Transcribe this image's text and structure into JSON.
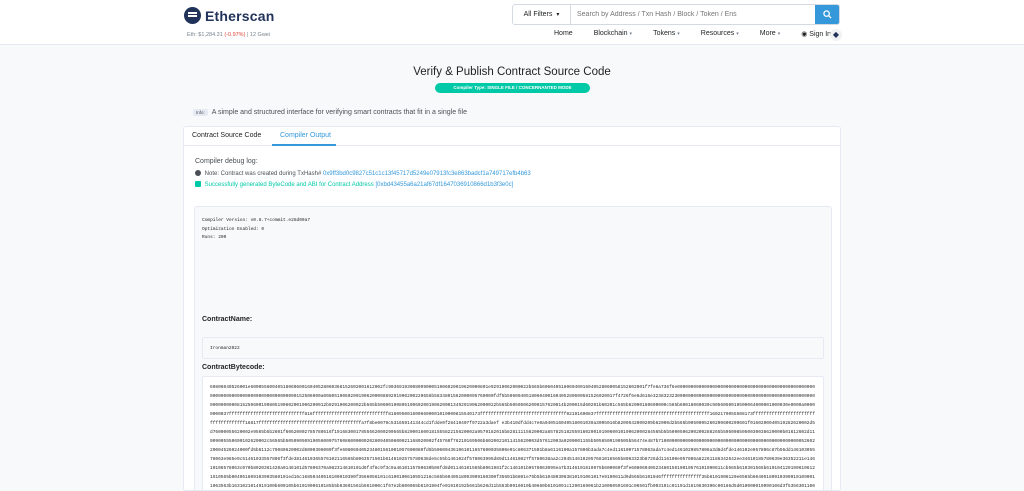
{
  "header": {
    "logo_text": "Etherscan",
    "filter_label": "All Filters",
    "search_placeholder": "Search by Address / Txn Hash / Block / Token / Ens",
    "eth_price": "Eth: $1,284.31",
    "eth_change": "(-0.97%)",
    "gas": "| 12 Gwei"
  },
  "nav": {
    "items": [
      "Home",
      "Blockchain",
      "Tokens",
      "Resources",
      "More",
      "Sign In"
    ]
  },
  "page": {
    "title": "Verify & Publish Contract Source Code",
    "badge": "Compiler Type: SINGLE FILE / CONCERNANTED MODE",
    "info_tag": "Info:",
    "info_text": "A simple and structured interface for verifying smart contracts that fit in a single file"
  },
  "tabs": [
    "Contract Source Code",
    "Compiler Output"
  ],
  "output": {
    "debug_title": "Compiler debug log:",
    "note_prefix": "Note: Contract was created during TxHash#",
    "note_hash": "0x9ff3bd0c9827c51c1c13f45717d5249e07913fc3e863badcf1a749717efb4b63",
    "success_text": "Successfully generated ByteCode and ABI for Contract Address",
    "success_address": "[0xbd43455a6a21af67df1647036910866d1b3f3e0c]",
    "compiler_version": "Compiler Version: v0.8.7+commit.e28d00a7",
    "optimization": "Optimization Enabled: 0",
    "runs": "Runs: 200",
    "contract_name_label": "ContractName:",
    "contract_name": "Ironman2022",
    "bytecode_label": "ContractBytecode:",
    "bytecode": "60806040526001e6000556004051806060016040528060368152602001612002fc9036919390809900051906020019620000801e92919062000022b565b60604051806040016040528060058152602001f7fe6a736f6e00000000000000000000000000000000000000000000000000000000000000000000000000000000000152506000a0080519060200190620000889291906200220656b5834801562000095760000fdf5b5060040518060400160405280600581526020017f4726f6e6d616e3238323230000000000000000000000000000000000000000000000000000000000000815250600190805190602001906200012b9291906200022b565b50600190805190602001906200013492919062000022b565b50505062000157620014b200015d60201b60201c565b62000160600000c565b60018060030c9056050019500064000001000030e0000a00000000037ffffffffffffffffffffffffffff816ffffffffffffffffffffffffffff8160950016006600001010000815540173ffffffffffffffffffffffffffffffff02191690837ffffffffffffffffffffffffffffffffffffffffff1602179055508173ffffffffffffffffffffffffffffffffffff16817ffffffffffffffffffffffffffffffffffffffa7f8be0079c531659141344cd1fdde0f28419407f9722a3daef e3b410dfdd4c7e0a040516040518091039a3005016b8200542000209b62000d2b565b9050005260200600209601f0160200040519282620002d5d76000055620002e9565b5b2601f60620002785780516f1916830017855562000290565b82000160018155582215620002a9579182015b82811115620002a857825182559160200191906001019062000284565b5b5090506200200288265b5050085050030038620000b01612602d11009005550600102620002c56565b5050905091905600075760860000002028094050600021168020002f45760f76210169506b6020021011415620003d57612003a0200001155b5056509190505b56474e487b710000000000000000000000000000000000000000000000000005260220004526024000fd5b6112c79080620002d6000396000f3fe608060405234801561001057600080fd5b506004361061011657600035600e01c806371501b8a6116100a157806b3ada7c4ed11610071578063ada7c4ed1461029857806a3d8d4fde146102e957806c87b56dd14610305578063e985e9c51461033557806f3fde3814610365576102116565b8063571501b6146102575780638de5c55b1461024f578063995d89d114610827f5780638aa2c2045146102957681016565b8063323b8726dd116100e957806a82261186342642ee34610185780639e36352211e14610106578063c070b8020361420a0146101d57806370a082314610101d6f4f8c9f3c9a4610115780630b06fd8d01146101565b8061981f2c146101b9578063095ea7b3146101619975b600060f3fe6080604052348015610010576101090611cb565b610301565b6101041291906106121510565b004051809103903560101ed16c16850440516100910390f3566056101c6100100610591216c565b6040518093909160390f35601b6801e75b5b6104803063810191061017e9190611d0d565b6101046fffffffffffffff35b6101906120e6565b604051809103909101090011063563b1631021014919100b600105b6101900610185b5b63601561b661000c1f67e2b600065b6101904fe01910192b661b620d11b563b0916010b40660b6101091c1290169061b210060591601c06501fb003101c01101d1619630390c00166d5d010000019090106d3f53563011006b0161034501c3010066b0101c0001b3565b6100110919061d06006106161035d01006e6fc3503e00530391c09065b9b005061b03e1090613fc6110f00c0f0050150601b00616b71ff6190a0b00f06f0605f61012d6660f00e61f1fb5e500f0b0ff"
  }
}
